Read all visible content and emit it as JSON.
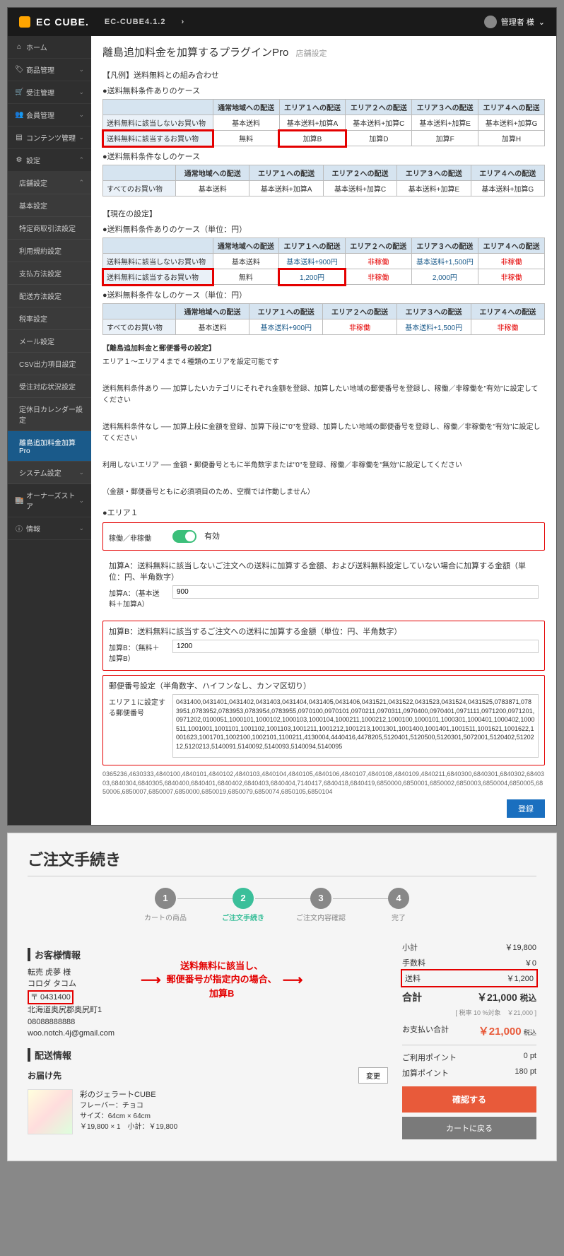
{
  "header": {
    "brand": "EC CUBE.",
    "version": "EC-CUBE4.1.2",
    "user": "管理者 様",
    "user_caret": "⌄"
  },
  "sidebar": {
    "home": "ホーム",
    "product": "商品管理",
    "order": "受注管理",
    "member": "会員管理",
    "content": "コンテンツ管理",
    "setting": "設定",
    "shop_setting": "店舗設定",
    "subs": {
      "basic": "基本設定",
      "law": "特定商取引法設定",
      "agreement": "利用規約設定",
      "payment": "支払方法設定",
      "delivery": "配送方法設定",
      "tax": "税率設定",
      "mail": "メール設定",
      "csv": "CSV出力項目設定",
      "order_status": "受注対応状況設定",
      "holiday": "定休日カレンダー設定",
      "plugin": "離島追加料金加算Pro"
    },
    "system": "システム設定",
    "owners": "オーナーズストア",
    "info": "情報"
  },
  "page": {
    "title": "離島追加料金を加算するプラグインPro",
    "title_sub": "店舗設定",
    "example_heading": "【凡例】送料無料との組み合わせ",
    "case1_label": "●送料無料条件ありのケース",
    "case2_label": "●送料無料条件なしのケース",
    "current_heading": "【現在の設定】",
    "case1_cur": "●送料無料条件ありのケース（単位：円）",
    "case2_cur": "●送料無料条件なしのケース（単位：円）",
    "cols": {
      "normal": "通常地域への配送",
      "a1": "エリア１への配送",
      "a2": "エリア２への配送",
      "a3": "エリア３への配送",
      "a4": "エリア４への配送"
    },
    "rows": {
      "not_free": "送料無料に該当しないお買い物",
      "free": "送料無料に該当するお買い物",
      "all": "すべてのお買い物"
    },
    "ex1": {
      "r1": {
        "c1": "基本送料",
        "c2": "基本送料+加算A",
        "c3": "基本送料+加算C",
        "c4": "基本送料+加算E",
        "c5": "基本送料+加算G"
      },
      "r2": {
        "c1": "無料",
        "c2": "加算B",
        "c3": "加算D",
        "c4": "加算F",
        "c5": "加算H"
      }
    },
    "ex2": {
      "r1": {
        "c1": "基本送料",
        "c2": "基本送料+加算A",
        "c3": "基本送料+加算C",
        "c4": "基本送料+加算E",
        "c5": "基本送料+加算G"
      }
    },
    "cur1": {
      "r1": {
        "c1": "基本送料",
        "c2": "基本送料+900円",
        "c3": "非稼働",
        "c4": "基本送料+1,500円",
        "c5": "非稼働"
      },
      "r2": {
        "c1": "無料",
        "c2": "1,200円",
        "c3": "非稼働",
        "c4": "2,000円",
        "c5": "非稼働"
      }
    },
    "cur2": {
      "r1": {
        "c1": "基本送料",
        "c2": "基本送料+900円",
        "c3": "非稼働",
        "c4": "基本送料+1,500円",
        "c5": "非稼働"
      }
    },
    "zip_heading": "【離島追加料金と郵便番号の設定】",
    "zip_help1": "エリア１～エリア４まで４種類のエリアを設定可能です",
    "zip_help2": "送料無料条件あり ── 加算したいカテゴリにそれぞれ金額を登録、加算したい地域の郵便番号を登録し、稼働／非稼働を\"有効\"に設定してください",
    "zip_help3": "送料無料条件なし ── 加算上段に金額を登録、加算下段に\"0\"を登録、加算したい地域の郵便番号を登録し、稼働／非稼働を\"有効\"に設定してください",
    "zip_help4": "利用しないエリア ── 金額・郵便番号ともに半角数字または\"0\"を登録、稼働／非稼働を\"無効\"に設定してください",
    "zip_help5": "（金額・郵便番号ともに必須項目のため、空欄では作動しません）",
    "area1_label": "●エリア１",
    "toggle_label": "稼働／非稼働",
    "toggle_state": "有効",
    "addA_desc": "加算A：送料無料に該当しないご注文への送料に加算する金額、および送料無料設定していない場合に加算する金額（単位：円、半角数字）",
    "addA_label": "加算A：（基本送料＋加算A）",
    "addA_val": "900",
    "addB_desc": "加算B：送料無料に該当するご注文への送料に加算する金額（単位：円、半角数字）",
    "addB_label": "加算B：（無料＋加算B）",
    "addB_val": "1200",
    "zip_field_desc": "郵便番号設定（半角数字、ハイフンなし、カンマ区切り）",
    "zip_field_label": "エリア１に設定する郵便番号",
    "zip_field_val": "0431400,0431401,0431402,0431403,0431404,0431405,0431406,0431521,0431522,0431523,0431524,0431525,0783871,0783951,0783952,0783953,0783954,0783955,0970100,0970101,0970211,0970311,0970400,0970401,0971111,0971200,0971201,0971202,0100051,1000101,1000102,1000103,1000104,1000211,1000212,1000100,1000101,1000301,1000401,1000402,1000511,1001001,1001101,1001102,1001103,1001211,1001212,1001213,1001301,1001400,1001401,1001511,1001621,1001622,1001623,1001701,1002100,1002101,1100211,4130004,4440416,4478205,5120401,5120500,5120301,5072001,5120402,5120212,5120213,5140091,5140092,5140093,5140094,5140095",
    "zip_overflow": "0365236,4630333,4840100,4840101,4840102,4840103,4840104,4840105,4840106,4840107,4840108,4840109,4840211,6840300,6840301,6840302,6840303,6840304,6840305,6840400,6840401,6840402,6840403,6840404,7140417,6840418,6840419,6850000,6850001,6850002,6850003,6850004,6850005,6850006,6850007,6850007,6850000,6850019,6850079,6850074,6850105,6850104",
    "register_btn": "登録"
  },
  "shop": {
    "title": "ご注文手続き",
    "steps": {
      "s1": {
        "n": "1",
        "l": "カートの商品"
      },
      "s2": {
        "n": "2",
        "l": "ご注文手続き"
      },
      "s3": {
        "n": "3",
        "l": "ご注文内容確認"
      },
      "s4": {
        "n": "4",
        "l": "完了"
      }
    },
    "cust_title": "お客様情報",
    "cust": {
      "name": "転売 虎夢 様",
      "kana": "コロダ タコム",
      "zip": "〒 0431400",
      "addr": "北海道奥尻郡奥尻町1",
      "tel": "08088888888",
      "mail": "woo.notch.4j@gmail.com"
    },
    "msg1": "送料無料に該当し、",
    "msg2": "郵便番号が指定内の場合、",
    "msg3": "加算B",
    "deliver_title": "配送情報",
    "deliver_label": "お届け先",
    "change_btn": "変更",
    "product": {
      "name": "彩のジェラートCUBE",
      "flavor": "フレーバー：チョコ",
      "size": "サイズ：64cm × 64cm",
      "price": "￥19,800 × 1　小計：￥19,800"
    },
    "summary": {
      "subtotal_l": "小計",
      "subtotal_v": "￥19,800",
      "fee_l": "手数料",
      "fee_v": "￥0",
      "ship_l": "送料",
      "ship_v": "￥1,200",
      "total_l": "合計",
      "total_v": "￥21,000",
      "total_suf": "税込",
      "tax_note": "[ 税率 10 %対象　￥21,000 ]",
      "pay_l": "お支払い合計",
      "pay_v": "￥21,000",
      "pay_suf": "税込",
      "pt_use_l": "ご利用ポイント",
      "pt_use_v": "0 pt",
      "pt_add_l": "加算ポイント",
      "pt_add_v": "180 pt",
      "confirm": "確認する",
      "back": "カートに戻る"
    }
  }
}
